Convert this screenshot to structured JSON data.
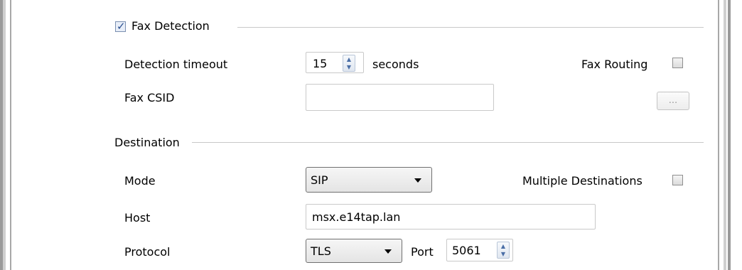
{
  "fax_detection": {
    "label": "Fax Detection",
    "checked": true,
    "timeout_label": "Detection timeout",
    "timeout_value": "15",
    "timeout_unit": "seconds",
    "fax_routing_label": "Fax Routing",
    "fax_routing_checked": false,
    "csid_label": "Fax CSID",
    "csid_value": "",
    "browse_label": "..."
  },
  "destination": {
    "label": "Destination",
    "mode_label": "Mode",
    "mode_value": "SIP",
    "multiple_label": "Multiple Destinations",
    "multiple_checked": false,
    "host_label": "Host",
    "host_value": "msx.e14tap.lan",
    "protocol_label": "Protocol",
    "protocol_value": "TLS",
    "port_label": "Port",
    "port_value": "5061"
  }
}
